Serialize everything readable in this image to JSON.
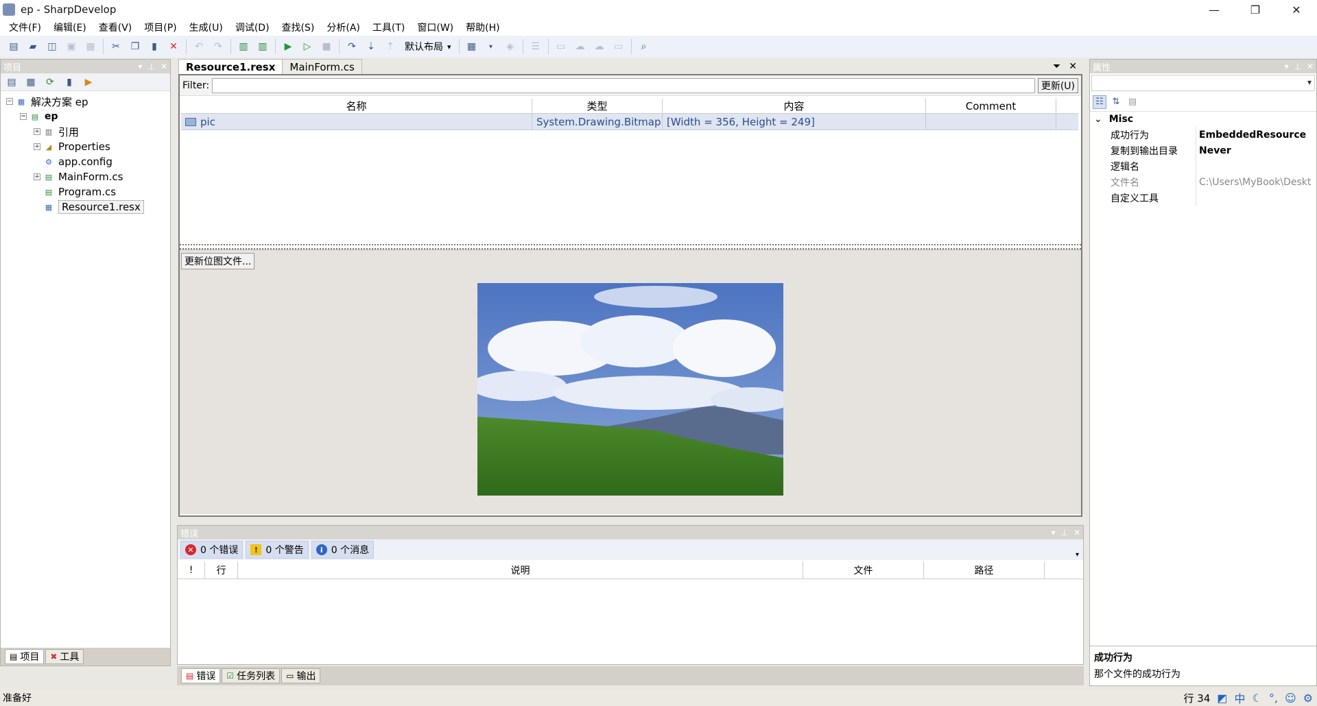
{
  "window": {
    "title": "ep - SharpDevelop",
    "minimize": "—",
    "maximize": "❐",
    "close": "✕"
  },
  "menu": [
    "文件(F)",
    "编辑(E)",
    "查看(V)",
    "项目(P)",
    "生成(U)",
    "调试(D)",
    "查找(S)",
    "分析(A)",
    "工具(T)",
    "窗口(W)",
    "帮助(H)"
  ],
  "toolbar": {
    "layout_combo": "默认布局"
  },
  "project_panel": {
    "title": "项目",
    "tree": {
      "solution": "解决方案 ep",
      "project": "ep",
      "items": [
        "引用",
        "Properties",
        "app.config",
        "MainForm.cs",
        "Program.cs",
        "Resource1.resx"
      ]
    },
    "tabs": [
      "项目",
      "工具"
    ]
  },
  "document": {
    "tabs": [
      "Resource1.resx",
      "MainForm.cs"
    ],
    "filter_label": "Filter:",
    "filter_value": "",
    "update_button": "更新(U)",
    "grid_headers": [
      "名称",
      "类型",
      "内容",
      "Comment"
    ],
    "rows": [
      {
        "name": "pic",
        "type": "System.Drawing.Bitmap",
        "content": "[Width = 356, Height = 249]",
        "comment": ""
      }
    ],
    "update_bitmap_button": "更新位图文件..."
  },
  "error_panel": {
    "title": "错误",
    "errors": "0 个错误",
    "warnings": "0 个警告",
    "messages": "0 个消息",
    "headers": [
      "!",
      "行",
      "说明",
      "文件",
      "路径"
    ],
    "tabs": [
      "错误",
      "任务列表",
      "输出"
    ]
  },
  "properties": {
    "title": "属性",
    "category": "Misc",
    "rows": [
      {
        "key": "成功行为",
        "value": "EmbeddedResource"
      },
      {
        "key": "复制到输出目录",
        "value": "Never"
      },
      {
        "key": "逻辑名",
        "value": ""
      },
      {
        "key": "文件名",
        "value": "C:\\Users\\MyBook\\Deskt"
      },
      {
        "key": "自定义工具",
        "value": ""
      }
    ],
    "desc_title": "成功行为",
    "desc_text": "那个文件的成功行为"
  },
  "status": {
    "text": "准备好",
    "line": "行 34",
    "ime": "中"
  },
  "colors": {
    "accent": "#2a4c8e",
    "error": "#d9262b",
    "warning": "#f2c418",
    "info": "#2f66c6"
  }
}
